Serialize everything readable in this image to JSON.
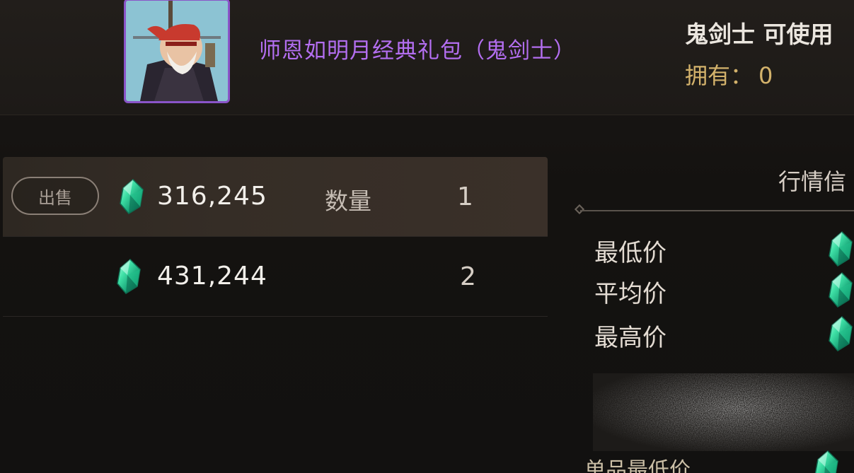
{
  "header": {
    "item_name": "师恩如明月经典礼包（鬼剑士）",
    "usable_text": "鬼剑士 可使用",
    "owned_label": "拥有：",
    "owned_value": "0",
    "avatar_icon": "character-portrait-icon"
  },
  "listing": {
    "sell_label": "出售",
    "qty_label": "数量",
    "currency_icon": "gem-icon",
    "rows": [
      {
        "price": "316,245",
        "qty": "1"
      },
      {
        "price": "431,244",
        "qty": "2"
      }
    ]
  },
  "market": {
    "title": "行情信",
    "stats": [
      {
        "label": "最低价"
      },
      {
        "label": "平均价"
      },
      {
        "label": "最高价"
      }
    ],
    "bottom_label": "单品最低价"
  },
  "colors": {
    "accent_purple": "#b36ef0",
    "gold": "#d3b26b",
    "gem_green": "#3fd9a0"
  }
}
